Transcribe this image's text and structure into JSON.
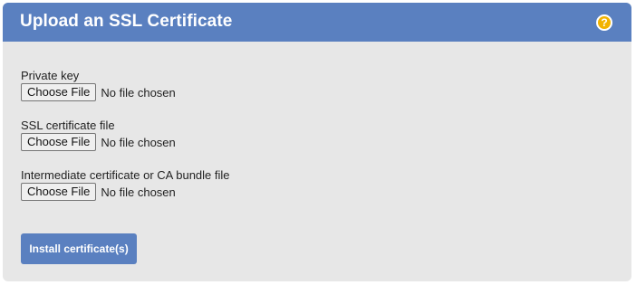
{
  "panel": {
    "title": "Upload an SSL Certificate",
    "help_icon_glyph": "?"
  },
  "fields": [
    {
      "label": "Private key",
      "button_label": "Choose File",
      "status": "No file chosen"
    },
    {
      "label": "SSL certificate file",
      "button_label": "Choose File",
      "status": "No file chosen"
    },
    {
      "label": "Intermediate certificate or CA bundle file",
      "button_label": "Choose File",
      "status": "No file chosen"
    }
  ],
  "actions": {
    "install_label": "Install certificate(s)"
  },
  "colors": {
    "header": "#5a80c0",
    "panel_bg": "#e7e7e7",
    "help_icon": "#f2b300",
    "button": "#5a80c0"
  }
}
